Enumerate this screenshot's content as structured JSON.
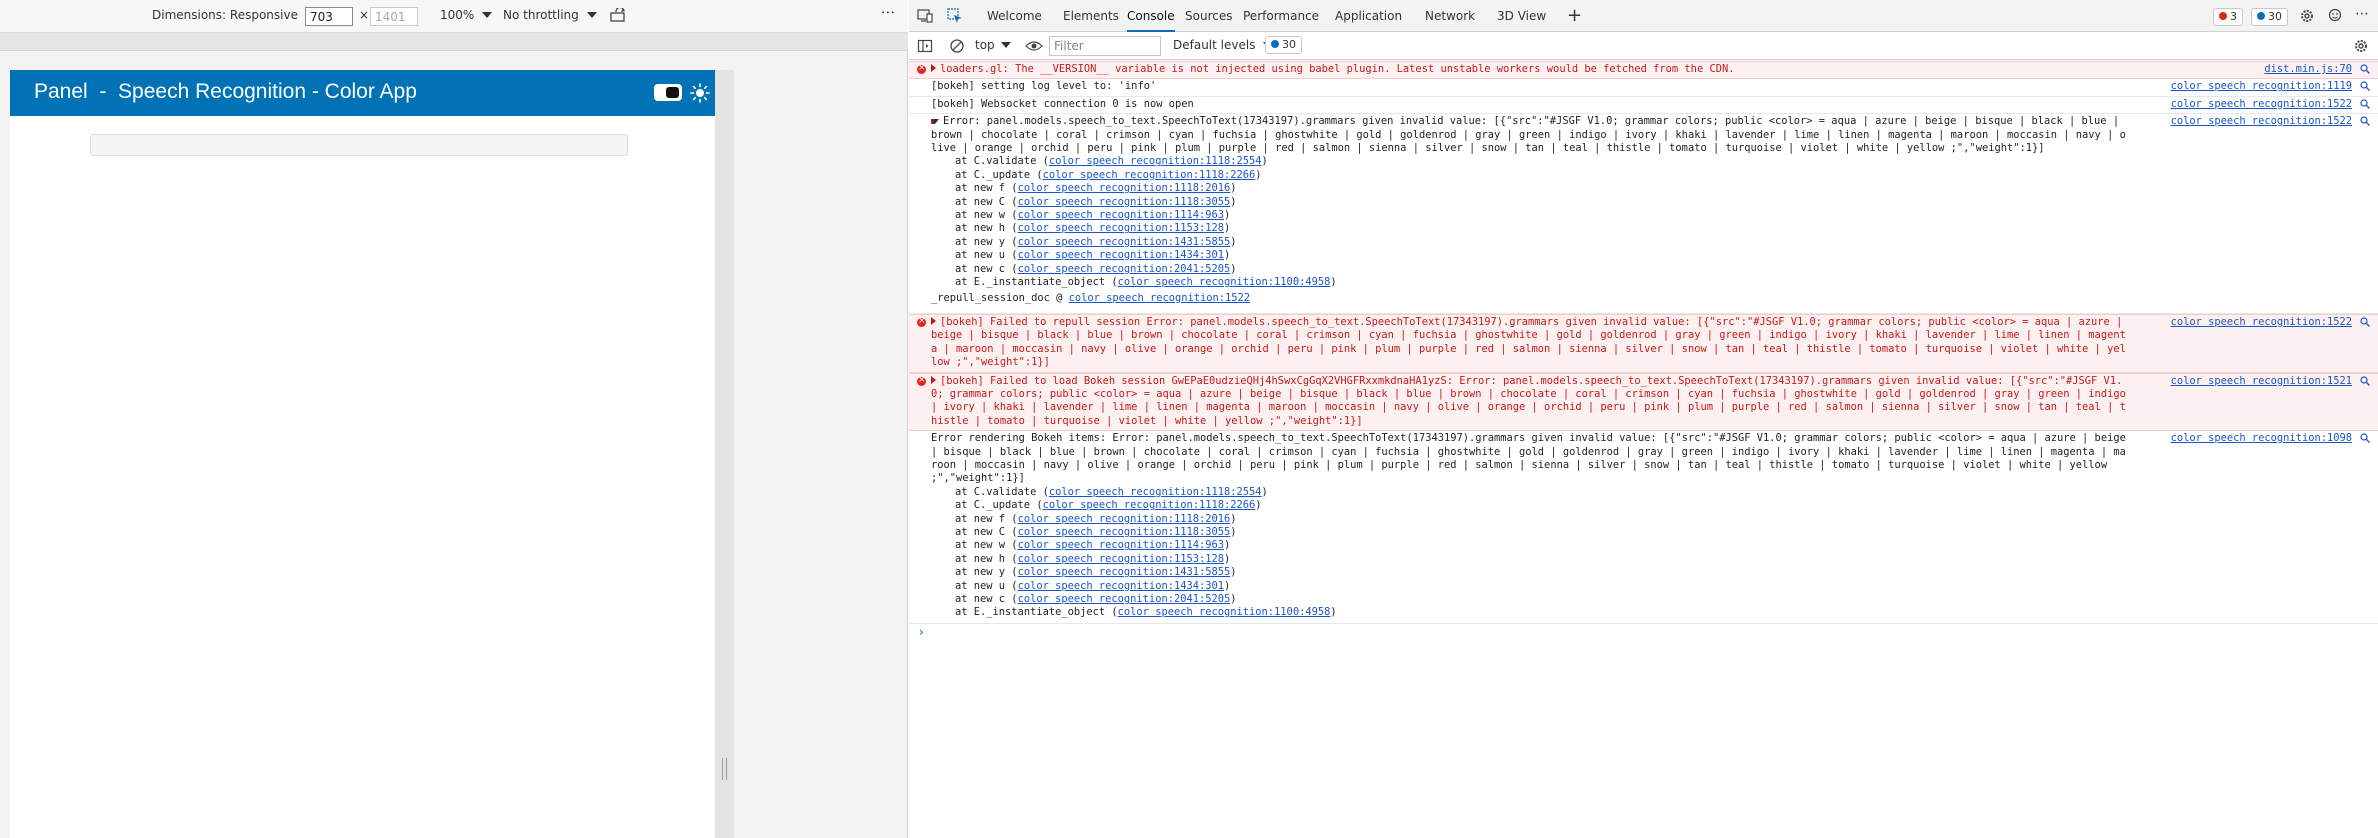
{
  "device_toolbar": {
    "dimensions_label": "Dimensions: Responsive",
    "width_value": "703",
    "height_value": "1401",
    "times": "×",
    "zoom": "100%",
    "throttling": "No throttling",
    "more": "⋮"
  },
  "app": {
    "title": "Panel  -  Speech Recognition - Color App",
    "header_color": "#0072b5"
  },
  "devtools": {
    "tabs": [
      {
        "label": "Welcome"
      },
      {
        "label": "Elements"
      },
      {
        "label": "Console"
      },
      {
        "label": "Sources"
      },
      {
        "label": "Performance"
      },
      {
        "label": "Application"
      },
      {
        "label": "Network"
      },
      {
        "label": "3D View"
      }
    ],
    "add_tab": "+",
    "error_count": "3",
    "issue_count": "30",
    "console_bar": {
      "context": "top",
      "filter_placeholder": "Filter",
      "levels": "Default levels",
      "issues": "30"
    }
  },
  "console": {
    "messages": [
      {
        "level": "error",
        "text": "loaders.gl: The __VERSION__ variable is not injected using babel plugin. Latest unstable workers would be fetched from the CDN.",
        "source": "dist.min.js:70",
        "collapsible": true
      },
      {
        "level": "info",
        "text": "[bokeh] setting log level to: 'info'",
        "source": "color speech recognition:1119"
      },
      {
        "level": "info",
        "text": "[bokeh] Websocket connection 0 is now open",
        "source": "color speech recognition:1522"
      },
      {
        "level": "error-expanded",
        "text": "Error: panel.models.speech_to_text.SpeechToText(17343197).grammars given invalid value: [{\"src\":\"#JSGF V1.0; grammar colors; public <color> = aqua | azure | beige | bisque | black | blue | brown | chocolate | coral | crimson | cyan | fuchsia | ghostwhite | gold | goldenrod | gray | green | indigo | ivory | khaki | lavender | lime | linen | magenta | maroon | moccasin | navy | olive | orange | orchid | peru | pink | plum | purple | red | salmon | sienna | silver | snow | tan | teal | thistle | tomato | turquoise | violet | white | yellow ;\",\"weight\":1}]",
        "source": "color speech recognition:1522",
        "stack": [
          {
            "fn": "at C.validate (",
            "loc": "color speech recognition:1118:2554",
            "end": ")"
          },
          {
            "fn": "at C._update (",
            "loc": "color speech recognition:1118:2266",
            "end": ")"
          },
          {
            "fn": "at new f (",
            "loc": "color speech recognition:1118:2016",
            "end": ")"
          },
          {
            "fn": "at new C (",
            "loc": "color speech recognition:1118:3055",
            "end": ")"
          },
          {
            "fn": "at new w (",
            "loc": "color speech recognition:1114:963",
            "end": ")"
          },
          {
            "fn": "at new h (",
            "loc": "color speech recognition:1153:128",
            "end": ")"
          },
          {
            "fn": "at new y (",
            "loc": "color speech recognition:1431:5855",
            "end": ")"
          },
          {
            "fn": "at new u (",
            "loc": "color speech recognition:1434:301",
            "end": ")"
          },
          {
            "fn": "at new c (",
            "loc": "color speech recognition:2041:5205",
            "end": ")"
          },
          {
            "fn": "at E._instantiate_object (",
            "loc": "color speech recognition:1100:4958",
            "end": ")"
          }
        ],
        "caller_fn": "_repull_session_doc @ ",
        "caller_loc": "color speech recognition:1522"
      },
      {
        "level": "error",
        "text": "[bokeh] Failed to repull session Error: panel.models.speech_to_text.SpeechToText(17343197).grammars given invalid value: [{\"src\":\"#JSGF V1.0; grammar colors; public <color> = aqua | azure | beige | bisque | black | blue | brown | chocolate | coral | crimson | cyan | fuchsia | ghostwhite | gold | goldenrod | gray | green | indigo | ivory | khaki | lavender | lime | linen | magenta | maroon | moccasin | navy | olive | orange | orchid | peru | pink | plum | purple | red | salmon | sienna | silver | snow | tan | teal | thistle | tomato | turquoise | violet | white | yellow ;\",\"weight\":1}]",
        "source": "color speech recognition:1522",
        "collapsible": true
      },
      {
        "level": "error",
        "text": "[bokeh] Failed to load Bokeh session GwEPaE0udzieQHj4hSwxCgGqX2VHGFRxxmkdnaHA1yzS: Error: panel.models.speech_to_text.SpeechToText(17343197).grammars given invalid value: [{\"src\":\"#JSGF V1.0; grammar colors; public <color> = aqua | azure | beige | bisque | black | blue | brown | chocolate | coral | crimson | cyan | fuchsia | ghostwhite | gold | goldenrod | gray | green | indigo | ivory | khaki | lavender | lime | linen | magenta | maroon | moccasin | navy | olive | orange | orchid | peru | pink | plum | purple | red | salmon | sienna | silver | snow | tan | teal | thistle | tomato | turquoise | violet | white | yellow ;\",\"weight\":1}]",
        "source": "color speech recognition:1521",
        "collapsible": true
      },
      {
        "level": "info-stack",
        "text": "Error rendering Bokeh items: Error: panel.models.speech_to_text.SpeechToText(17343197).grammars given invalid value: [{\"src\":\"#JSGF V1.0; grammar colors; public <color> = aqua | azure | beige | bisque | black | blue | brown | chocolate | coral | crimson | cyan | fuchsia | ghostwhite | gold | goldenrod | gray | green | indigo | ivory | khaki | lavender | lime | linen | magenta | maroon | moccasin | navy | olive | orange | orchid | peru | pink | plum | purple | red | salmon | sienna | silver | snow | tan | teal | thistle | tomato | turquoise | violet | white | yellow ;\",\"weight\":1}]",
        "source": "color speech recognition:1098",
        "stack": [
          {
            "fn": "at C.validate (",
            "loc": "color speech recognition:1118:2554",
            "end": ")"
          },
          {
            "fn": "at C._update (",
            "loc": "color speech recognition:1118:2266",
            "end": ")"
          },
          {
            "fn": "at new f (",
            "loc": "color speech recognition:1118:2016",
            "end": ")"
          },
          {
            "fn": "at new C (",
            "loc": "color speech recognition:1118:3055",
            "end": ")"
          },
          {
            "fn": "at new w (",
            "loc": "color speech recognition:1114:963",
            "end": ")"
          },
          {
            "fn": "at new h (",
            "loc": "color speech recognition:1153:128",
            "end": ")"
          },
          {
            "fn": "at new y (",
            "loc": "color speech recognition:1431:5855",
            "end": ")"
          },
          {
            "fn": "at new u (",
            "loc": "color speech recognition:1434:301",
            "end": ")"
          },
          {
            "fn": "at new c (",
            "loc": "color speech recognition:2041:5205",
            "end": ")"
          },
          {
            "fn": "at E._instantiate_object (",
            "loc": "color speech recognition:1100:4958",
            "end": ")"
          }
        ]
      }
    ],
    "prompt": "›"
  }
}
